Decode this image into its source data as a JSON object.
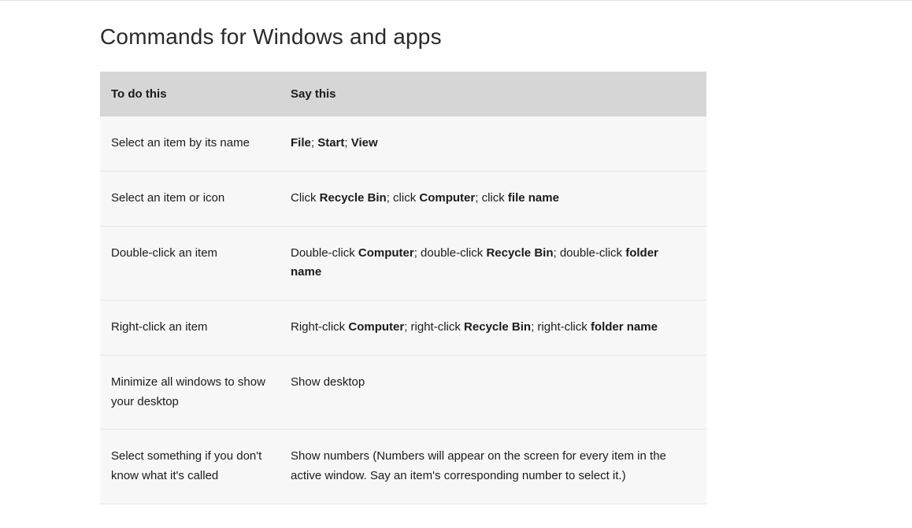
{
  "title": "Commands for Windows and apps",
  "table": {
    "headers": [
      "To do this",
      "Say this"
    ],
    "rows": [
      {
        "action": "Select an item by its name",
        "say_parts": [
          {
            "t": "File",
            "b": true
          },
          {
            "t": "; ",
            "b": false
          },
          {
            "t": "Start",
            "b": true
          },
          {
            "t": "; ",
            "b": false
          },
          {
            "t": "View",
            "b": true
          }
        ]
      },
      {
        "action": "Select an item or icon",
        "say_parts": [
          {
            "t": "Click ",
            "b": false
          },
          {
            "t": "Recycle Bin",
            "b": true
          },
          {
            "t": "; click ",
            "b": false
          },
          {
            "t": "Computer",
            "b": true
          },
          {
            "t": "; click ",
            "b": false
          },
          {
            "t": "file name",
            "b": true
          }
        ]
      },
      {
        "action": "Double-click an item",
        "say_parts": [
          {
            "t": "Double-click ",
            "b": false
          },
          {
            "t": "Computer",
            "b": true
          },
          {
            "t": "; double-click ",
            "b": false
          },
          {
            "t": "Recycle Bin",
            "b": true
          },
          {
            "t": "; double-click ",
            "b": false
          },
          {
            "t": "folder name",
            "b": true
          }
        ]
      },
      {
        "action": "Right-click an item",
        "say_parts": [
          {
            "t": "Right-click ",
            "b": false
          },
          {
            "t": "Computer",
            "b": true
          },
          {
            "t": "; right-click ",
            "b": false
          },
          {
            "t": "Recycle Bin",
            "b": true
          },
          {
            "t": "; right-click ",
            "b": false
          },
          {
            "t": "folder name",
            "b": true
          }
        ]
      },
      {
        "action": "Minimize all windows to show your desktop",
        "say_parts": [
          {
            "t": "Show desktop",
            "b": false
          }
        ]
      },
      {
        "action": "Select something if you don't know what it's called",
        "say_parts": [
          {
            "t": "Show numbers (Numbers will appear on the screen for every item in the active window. Say an item's corresponding number to select it.)",
            "b": false
          }
        ]
      }
    ]
  }
}
